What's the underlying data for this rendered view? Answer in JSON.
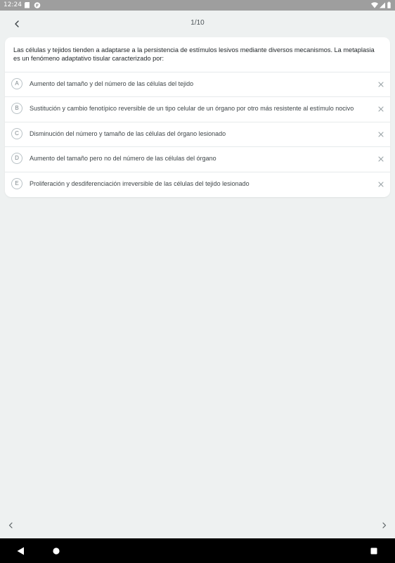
{
  "status_bar": {
    "time": "12:24",
    "icons": [
      "sd-card-icon",
      "app-notification-icon",
      "wifi-icon",
      "signal-icon",
      "battery-icon"
    ]
  },
  "header": {
    "progress": "1/10",
    "back_icon": "chevron-left-icon"
  },
  "question": {
    "text": "Las células y tejidos tienden a adaptarse a la persistencia de estímulos lesivos mediante diversos mecanismos. La metaplasia es un fenómeno adaptativo tisular caracterizado por:",
    "options": [
      {
        "letter": "A",
        "text": "Aumento del tamaño y del número de las células del tejido"
      },
      {
        "letter": "B",
        "text": "Sustitución y cambio fenotípico reversible de un tipo celular de un órgano por otro más resistente al estímulo nocivo"
      },
      {
        "letter": "C",
        "text": "Disminución del número y tamaño de las células del órgano lesionado"
      },
      {
        "letter": "D",
        "text": "Aumento del tamaño pero no del número de las células del órgano"
      },
      {
        "letter": "E",
        "text": "Proliferación y desdiferenciación irreversible de las células del tejido lesionado"
      }
    ]
  },
  "navigation": {
    "prev_icon": "chevron-left-icon",
    "next_icon": "chevron-right-icon"
  },
  "system_nav": {
    "icons": [
      "back-triangle-icon",
      "home-circle-icon",
      "recents-square-icon"
    ]
  },
  "colors": {
    "background": "#eef1f1",
    "card": "#ffffff",
    "status_bar": "#9e9e9e",
    "system_nav": "#000000"
  }
}
